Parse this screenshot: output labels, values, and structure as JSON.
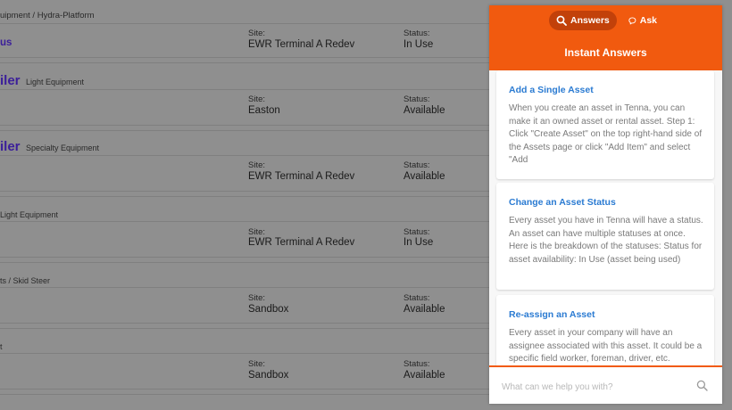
{
  "background": {
    "breadcrumb": "uipment / Hydra-Platform",
    "rows": [
      {
        "name": "us",
        "category": "",
        "site_label": "Site:",
        "site": "EWR Terminal A Redev",
        "status_label": "Status:",
        "status": "In Use"
      },
      {
        "name": "iler",
        "category": "Light Equipment",
        "site_label": "Site:",
        "site": "Easton",
        "status_label": "Status:",
        "status": "Available"
      },
      {
        "name": "iler",
        "category": "Specialty Equipment",
        "site_label": "Site:",
        "site": "EWR Terminal A Redev",
        "status_label": "Status:",
        "status": "Available"
      },
      {
        "name": "",
        "category": "Light Equipment",
        "site_label": "Site:",
        "site": "EWR Terminal A Redev",
        "status_label": "Status:",
        "status": "In Use"
      },
      {
        "name": "",
        "category": "ts / Skid Steer",
        "site_label": "Site:",
        "site": "Sandbox",
        "status_label": "Status:",
        "status": "Available"
      },
      {
        "name": "",
        "category": "t",
        "site_label": "Site:",
        "site": "Sandbox",
        "status_label": "Status:",
        "status": "Available"
      }
    ]
  },
  "panel": {
    "tabs": {
      "answers": "Answers",
      "ask": "Ask"
    },
    "title": "Instant Answers",
    "articles": [
      {
        "title": "Add a Single Asset",
        "body": "When you create an asset in Tenna, you can make it an owned asset or rental asset. Step 1: Click \"Create Asset\" on the top right-hand side of the Assets page or click \"Add Item\" and select \"Add"
      },
      {
        "title": "Change an Asset Status",
        "body": "Every asset you have in Tenna will have a status. An asset can have multiple statuses at once. Here is the breakdown of the statuses: Status for asset availability: In Use (asset being used)"
      },
      {
        "title": "Re-assign an Asset",
        "body": "Every asset in your company will have an assignee associated with this asset. It could be a specific field worker, foreman, driver, etc."
      }
    ],
    "search": {
      "placeholder": "What can we help you with?"
    }
  },
  "colors": {
    "brand_orange": "#f15a0f",
    "link_blue": "#2b7bd2",
    "asset_purple": "#3b1e9a"
  },
  "icons": {
    "answers": "search-icon",
    "ask": "chat-bubble-icon",
    "search": "search-icon"
  }
}
